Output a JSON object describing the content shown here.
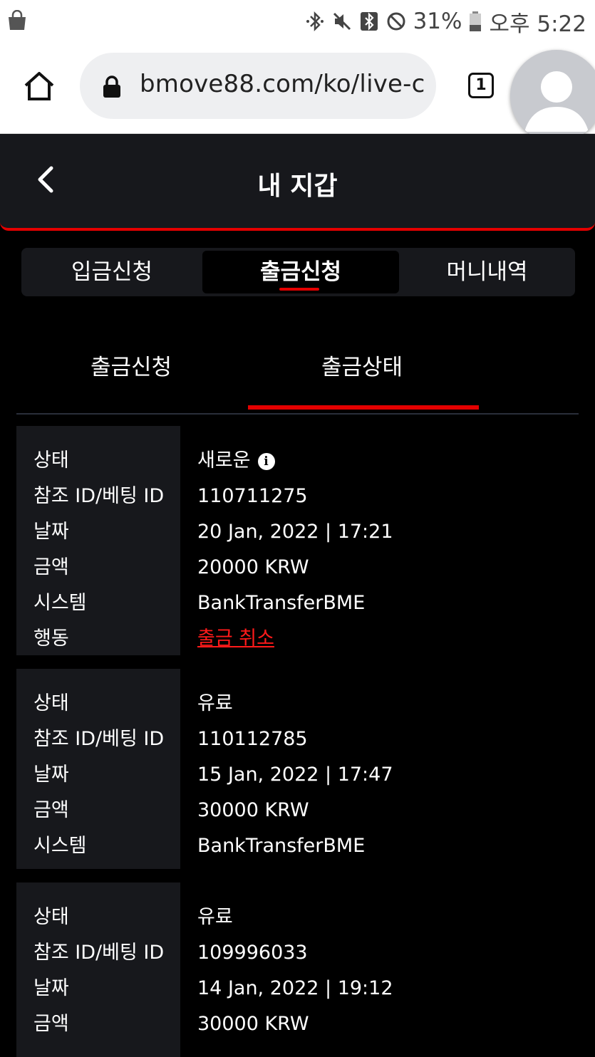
{
  "status_bar": {
    "battery": "31%",
    "time": "오후 5:22"
  },
  "browser": {
    "url": "bmove88.com/ko/live-c",
    "tab_count": "1"
  },
  "header": {
    "title": "내 지갑"
  },
  "tabs": [
    "입금신청",
    "출금신청",
    "머니내역"
  ],
  "subtabs": [
    "출금신청",
    "출금상태"
  ],
  "cards": [
    {
      "status_label": "상태",
      "status": "새로운",
      "ref_label": "참조 ID/베팅 ID",
      "ref": "110711275",
      "date_label": "날짜",
      "date": "20 Jan, 2022 | 17:21",
      "amount_label": "금액",
      "amount": "20000 KRW",
      "system_label": "시스템",
      "system": "BankTransferBME",
      "action_label": "행동",
      "action": "출금 취소"
    },
    {
      "status_label": "상태",
      "status": "유료",
      "ref_label": "참조 ID/베팅 ID",
      "ref": "110112785",
      "date_label": "날짜",
      "date": "15 Jan, 2022 | 17:47",
      "amount_label": "금액",
      "amount": "30000 KRW",
      "system_label": "시스템",
      "system": "BankTransferBME"
    },
    {
      "status_label": "상태",
      "status": "유료",
      "ref_label": "참조 ID/베팅 ID",
      "ref": "109996033",
      "date_label": "날짜",
      "date": "14 Jan, 2022 | 19:12",
      "amount_label": "금액",
      "amount": "30000 KRW"
    }
  ]
}
